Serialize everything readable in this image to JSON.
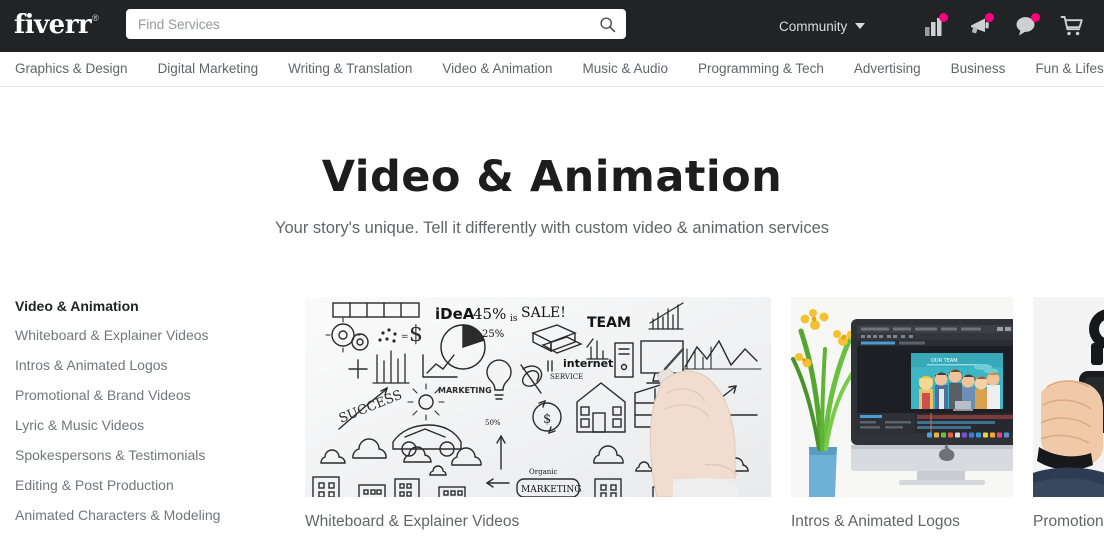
{
  "brand": {
    "name": "fiverr",
    "registered_mark": "®",
    "accent_color": "#1dbf73",
    "header_bg": "#222325",
    "notification_dot_color": "#ff007f"
  },
  "search": {
    "placeholder": "Find Services",
    "value": "",
    "icon": "search-icon"
  },
  "header": {
    "community_label": "Community",
    "chevron_icon": "chevron-down-icon",
    "icons": [
      {
        "name": "analytics-icon",
        "badge": true
      },
      {
        "name": "megaphone-icon",
        "badge": true
      },
      {
        "name": "messages-icon",
        "badge": true
      },
      {
        "name": "cart-icon",
        "badge": false
      }
    ]
  },
  "nav": {
    "items": [
      {
        "label": "Graphics & Design"
      },
      {
        "label": "Digital Marketing"
      },
      {
        "label": "Writing & Translation"
      },
      {
        "label": "Video & Animation"
      },
      {
        "label": "Music & Audio"
      },
      {
        "label": "Programming & Tech"
      },
      {
        "label": "Advertising"
      },
      {
        "label": "Business"
      },
      {
        "label": "Fun & Lifestyle"
      }
    ]
  },
  "hero": {
    "title": "Video & Animation",
    "subtitle": "Your story's unique. Tell it differently with custom video & animation services"
  },
  "sidebar": {
    "heading": "Video & Animation",
    "items": [
      {
        "label": "Whiteboard & Explainer Videos"
      },
      {
        "label": "Intros & Animated Logos"
      },
      {
        "label": "Promotional & Brand Videos"
      },
      {
        "label": "Lyric & Music Videos"
      },
      {
        "label": "Spokespersons & Testimonials"
      },
      {
        "label": "Editing & Post Production"
      },
      {
        "label": "Animated Characters & Modeling"
      }
    ]
  },
  "cards": [
    {
      "label": "Whiteboard & Explainer Videos",
      "image": "whiteboard-doodles-hand-drawing"
    },
    {
      "label": "Intros & Animated Logos",
      "image": "imac-video-editor-cartoon-team"
    },
    {
      "label": "Promotional & Brand Videos",
      "image": "hand-holding-camera-gimbal"
    }
  ]
}
